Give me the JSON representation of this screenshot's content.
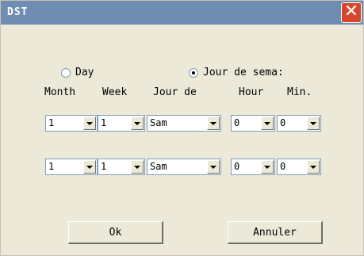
{
  "window": {
    "title": "DST",
    "close_label": "✕"
  },
  "mode": {
    "options": [
      {
        "label": "Day",
        "selected": false
      },
      {
        "label": "Jour de sema:",
        "selected": true
      }
    ]
  },
  "columns": [
    "Month",
    "Week",
    "Jour de",
    "Hour",
    "Min."
  ],
  "rows": [
    {
      "month": "1",
      "week": "1",
      "day": "Sam",
      "hour": "0",
      "min": "0"
    },
    {
      "month": "1",
      "week": "1",
      "day": "Sam",
      "hour": "0",
      "min": "0"
    }
  ],
  "buttons": {
    "ok": "Ok",
    "cancel": "Annuler"
  }
}
